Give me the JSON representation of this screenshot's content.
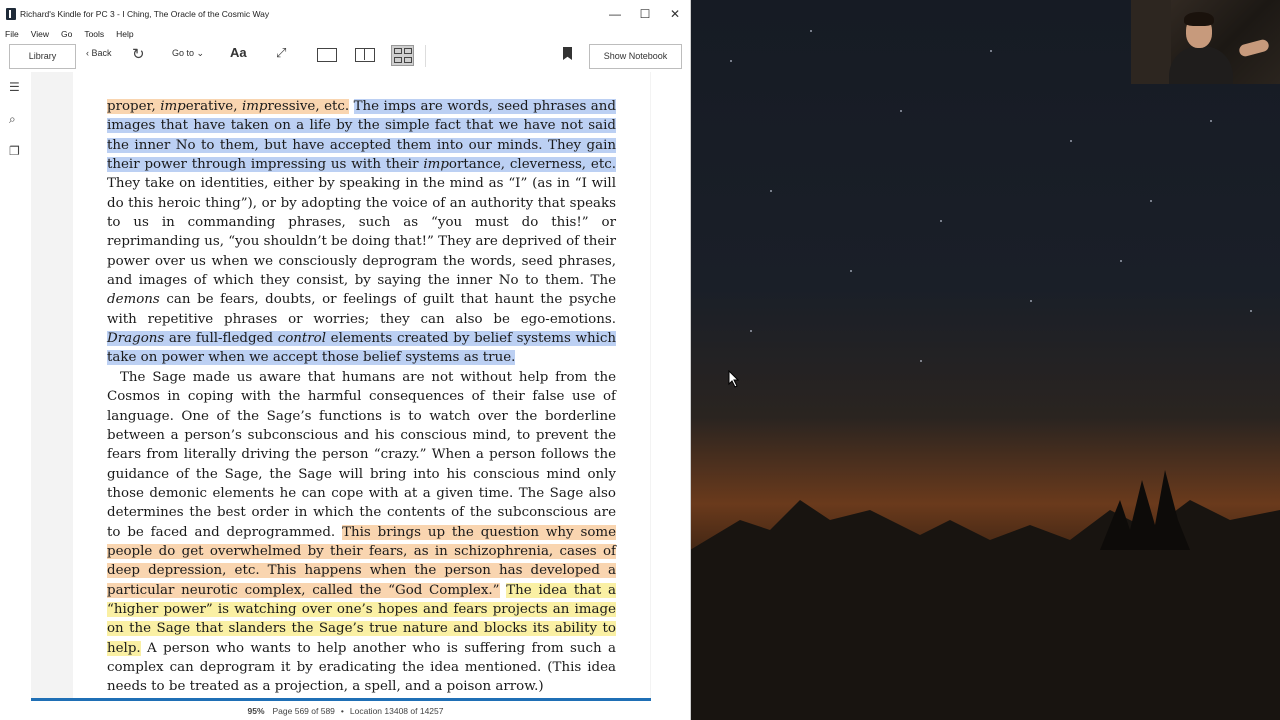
{
  "window": {
    "title": "Richard's Kindle for PC 3 - I Ching, The Oracle of the Cosmic Way",
    "controls": {
      "minimize": "—",
      "maximize": "☐",
      "close": "✕"
    }
  },
  "menu": {
    "items": [
      "File",
      "View",
      "Go",
      "Tools",
      "Help"
    ]
  },
  "toolbar": {
    "library_label": "Library",
    "back_label": "Back",
    "goto_label": "Go to",
    "font_label": "Aa",
    "notebook_label": "Show Notebook"
  },
  "sidebar": {
    "icons": [
      "toc-icon",
      "search-icon",
      "flashcards-icon"
    ]
  },
  "reader": {
    "p1": {
      "s1_a": "proper, ",
      "s1_b": "imp",
      "s1_c": "erative, ",
      "s1_d": "imp",
      "s1_e": "ressive, etc.",
      "s2": "The imps are words, seed phrases and images that have taken on a life by the simple fact that we have not said the inner No to them, but have accepted them into our minds. They gain their power through impressing us with their ",
      "s2_em": "imp",
      "s2_end": "ortance, cleverness, etc.",
      "s3": " They take on identities, either by speaking in the mind as “I” (as in “I will do this heroic thing”), or by adopting the voice of an authority that speaks to us in commanding phrases, such as “you must do this!” or reprimanding us, “you shouldn’t be doing that!” They are deprived of their power over us when we consciously deprogram the words, seed phrases, and images of which they consist, by saying the inner No to them. The ",
      "s3_em": "demons",
      "s3_end": " can be fears, doubts, or feelings of guilt that haunt the psyche with repetitive phrases or worries; they can also be ego-emotions. ",
      "s4_em1": "Dragons",
      "s4_mid": " are full-fledged ",
      "s4_em2": "control",
      "s4_end": " elements created by belief systems which take on power when we accept those belief systems as true."
    },
    "p2": {
      "plain": "The Sage made us aware that humans are not without help from the Cosmos in coping with the harmful consequences of their false use of language. One of the Sage’s functions is to watch over the borderline between a person’s subconscious and his conscious mind, to prevent the fears from literally driving the person “crazy.” When a person follows the guidance of the Sage, the Sage will bring into his conscious mind only those demonic elements he can cope with at a given time. The Sage also determines the best order in which the contents of the subconscious are to be faced and deprogrammed. ",
      "orange": "This brings up the question why some people do get overwhelmed by their fears, as in schizophrenia, cases of deep depression, etc. This happens when the person has developed a particular neurotic complex, called the “God Complex.”",
      "gap": " ",
      "yellow": "The idea that a “higher power” is watching over one’s hopes and fears projects an image on the Sage that slanders the Sage’s true nature and blocks its ability to help.",
      "end": " A person who wants to help another who is suffering from such a complex can deprogram it by eradicating the idea mentioned. (This idea needs to be treated as a projection, a spell, and a poison arrow.)"
    }
  },
  "status": {
    "percent": "95%",
    "page": "Page 569 of 589",
    "separator": "•",
    "location": "Location 13408 of 14257",
    "progress_fraction": 0.95
  },
  "colors": {
    "highlight_orange": "#f9d5b0",
    "highlight_blue": "#bcd0f3",
    "highlight_yellow": "#faf0a4",
    "progress": "#1f6fb5"
  }
}
